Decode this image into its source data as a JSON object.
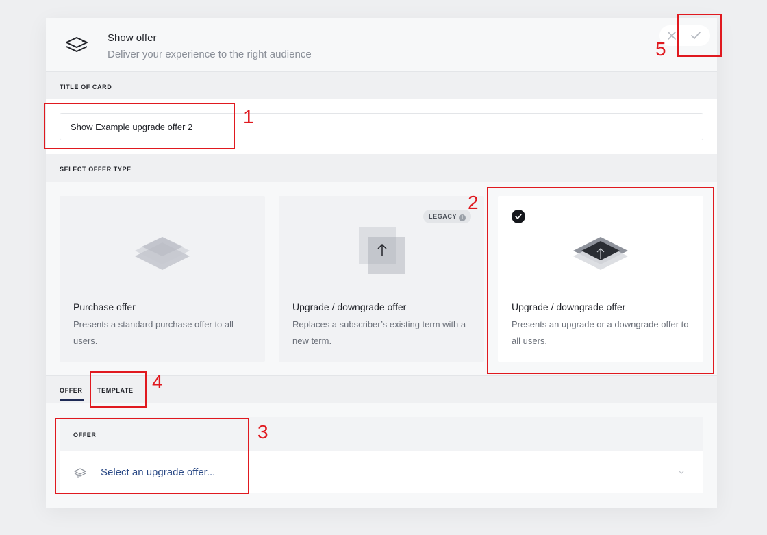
{
  "header": {
    "title": "Show offer",
    "subtitle": "Deliver your experience to the right audience",
    "icon": "layers-icon",
    "close_icon": "close-icon",
    "confirm_icon": "check-icon"
  },
  "title_section": {
    "label": "TITLE OF CARD",
    "value": "Show Example upgrade offer 2"
  },
  "offer_type_section": {
    "label": "SELECT OFFER TYPE",
    "cards": [
      {
        "title": "Purchase offer",
        "description": "Presents a standard purchase offer to all users.",
        "badge": "",
        "selected": false
      },
      {
        "title": "Upgrade / downgrade offer",
        "description": "Replaces a subscriber’s existing term with a new term.",
        "badge": "LEGACY",
        "selected": false
      },
      {
        "title": "Upgrade / downgrade offer",
        "description": "Presents an upgrade or a downgrade offer to all users.",
        "badge": "",
        "selected": true
      }
    ]
  },
  "tabs": [
    {
      "label": "OFFER",
      "active": true
    },
    {
      "label": "TEMPLATE",
      "active": false
    }
  ],
  "offer_panel": {
    "label": "OFFER",
    "select_placeholder": "Select an upgrade offer...",
    "select_icon": "upgrade-layers-icon",
    "chevron_icon": "chevron-down-icon"
  },
  "annotations": [
    "1",
    "2",
    "3",
    "4",
    "5"
  ],
  "colors": {
    "accent_red": "#e0191f",
    "link_blue": "#2b4a86",
    "tab_underline": "#1e2a55"
  }
}
